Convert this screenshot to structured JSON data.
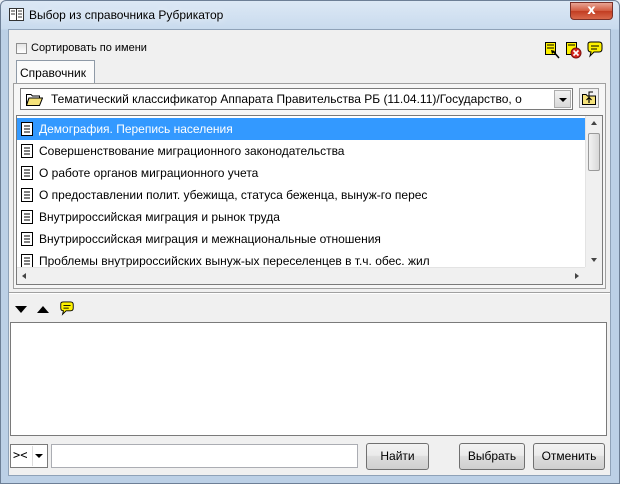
{
  "window": {
    "title": "Выбор из справочника Рубрикатор",
    "close_symbol": "x"
  },
  "options": {
    "sort_by_name_label": "Сортировать по имени",
    "sort_by_name_checked": false
  },
  "toolbar_icons": [
    "select-note-icon",
    "delete-note-icon",
    "comment-icon"
  ],
  "tabs": [
    {
      "label": "Справочник",
      "active": true
    }
  ],
  "catalog": {
    "selected": "Тематический классификатор Аппарата Правительства РБ (11.04.11)/Государство, о",
    "folder_icon": "open-folder-icon",
    "up_icon": "folder-up-icon"
  },
  "rubrics": [
    {
      "label": "Демография. Перепись населения",
      "selected": true
    },
    {
      "label": "Совершенствование миграционного законодательства",
      "selected": false
    },
    {
      "label": "О работе органов миграционного учета",
      "selected": false
    },
    {
      "label": "О предоставлении полит. убежища, статуса беженца, вынуж-го перес",
      "selected": false
    },
    {
      "label": "Внутрироссийская миграция и рынок труда",
      "selected": false
    },
    {
      "label": "Внутрироссийская миграция и межнациональные отношения",
      "selected": false
    },
    {
      "label": "Проблемы внутрироссийских вынуж-ых переселенцев в т.ч. обес. жил",
      "selected": false
    }
  ],
  "nav": {
    "icons": [
      "move-down-icon",
      "move-up-icon",
      "comment-icon"
    ]
  },
  "memo": {
    "text": ""
  },
  "search": {
    "mode": "><",
    "value": ""
  },
  "buttons": {
    "find": "Найти",
    "select": "Выбрать",
    "cancel": "Отменить"
  },
  "colors": {
    "selection": "#3399ff",
    "close_button": "#c7402a",
    "note_yellow": "#fff200"
  }
}
